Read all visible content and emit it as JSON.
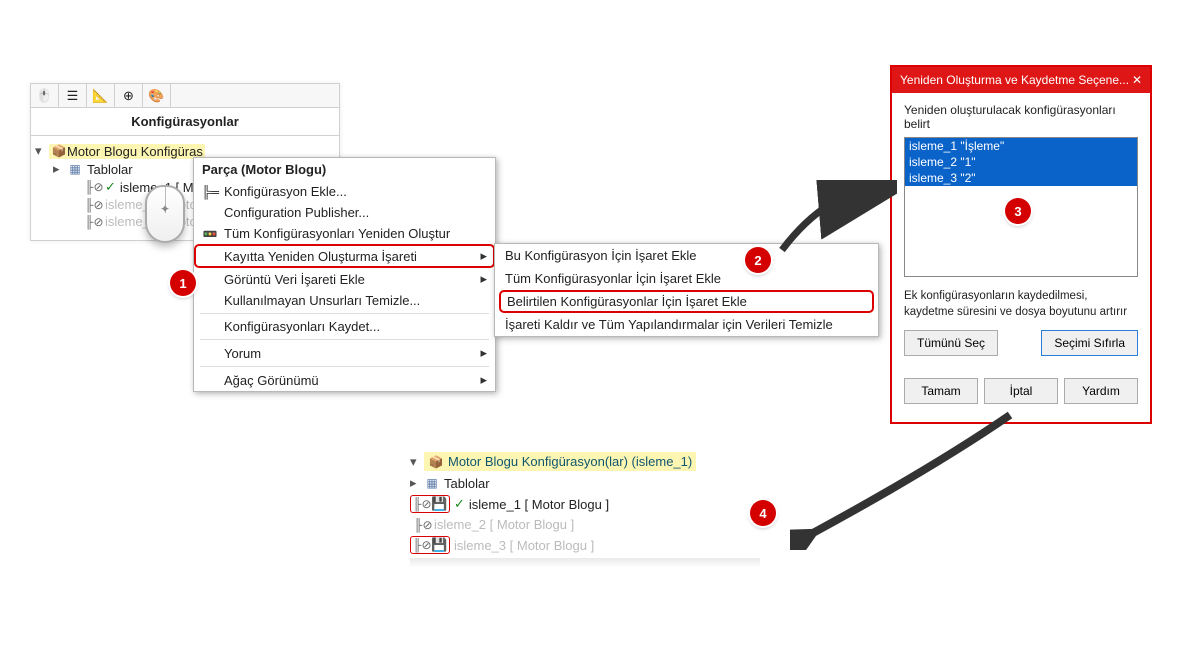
{
  "panel1": {
    "title": "Konfigürasyonlar",
    "root": "Motor Blogu Konfigüras",
    "tables": "Tablolar",
    "rows": [
      {
        "label": "isleme_1 [ Motor",
        "checked": true
      },
      {
        "label": "isleme_2 [ Motor",
        "faded": true
      },
      {
        "label": "isleme_3 [ Motor",
        "faded": true
      }
    ]
  },
  "menu": {
    "title": "Parça (Motor Blogu)",
    "items": {
      "add": "Konfigürasyon Ekle...",
      "pub": "Configuration Publisher...",
      "rebuild_all": "Tüm Konfigürasyonları Yeniden Oluştur",
      "save_mark": "Kayıtta Yeniden Oluşturma İşareti",
      "appearance": "Görüntü Veri İşareti Ekle",
      "purge": "Kullanılmayan Unsurları Temizle...",
      "save": "Konfigürasyonları Kaydet...",
      "comment": "Yorum",
      "tree": "Ağaç Görünümü"
    }
  },
  "submenu": {
    "a": "Bu Konfigürasyon İçin İşaret Ekle",
    "b": "Tüm Konfigürasyonlar İçin İşaret Ekle",
    "c": "Belirtilen Konfigürasyonlar İçin İşaret Ekle",
    "d": "İşareti Kaldır ve Tüm Yapılandırmalar için Verileri Temizle"
  },
  "dialog": {
    "title": "Yeniden Oluşturma ve Kaydetme Seçene...",
    "subtitle": "Yeniden oluşturulacak konfigürasyonları belirt",
    "list": [
      "isleme_1 \"İşleme\"",
      "isleme_2 \"1\"",
      "isleme_3 \"2\""
    ],
    "hint": "Ek konfigürasyonların kaydedilmesi, kaydetme süresini ve dosya boyutunu artırır",
    "select_all": "Tümünü Seç",
    "reset": "Seçimi Sıfırla",
    "ok": "Tamam",
    "cancel": "İptal",
    "help": "Yardım"
  },
  "panel2": {
    "root": "Motor Blogu Konfigürasyon(lar)  (isleme_1)",
    "tables": "Tablolar",
    "rows": [
      {
        "label": "isleme_1 [ Motor Blogu ]",
        "checked": true,
        "disk": true
      },
      {
        "label": "isleme_2 [ Motor Blogu ]",
        "faded": true
      },
      {
        "label": "isleme_3 [ Motor Blogu ]",
        "faded": true,
        "disk": true
      }
    ]
  },
  "badges": {
    "b1": "1",
    "b2": "2",
    "b3": "3",
    "b4": "4"
  }
}
